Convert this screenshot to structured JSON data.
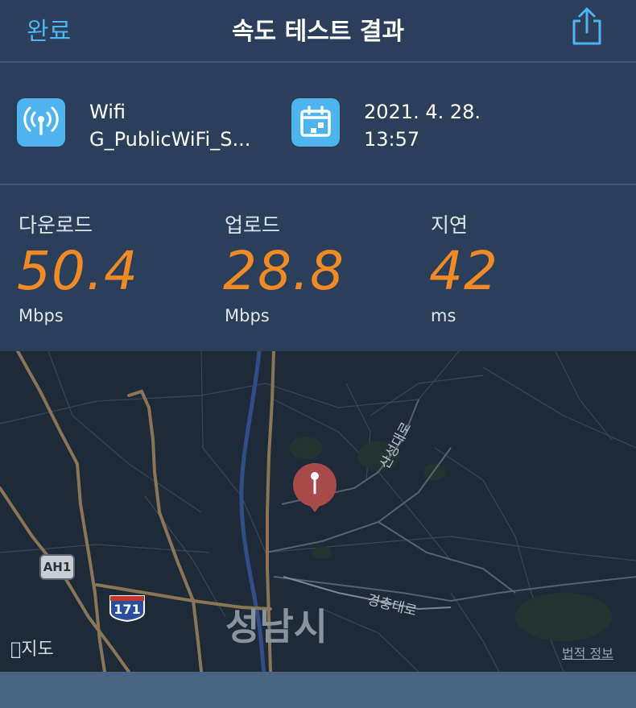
{
  "navbar": {
    "done_label": "완료",
    "title": "속도 테스트 결과",
    "share_icon": "share-icon"
  },
  "connection": {
    "type": "Wifi",
    "network_name": "G_PublicWiFi_S...",
    "icon": "wifi-antenna-icon"
  },
  "test_time": {
    "date": "2021. 4. 28.",
    "time": "13:57",
    "icon": "calendar-icon"
  },
  "metrics": {
    "download": {
      "label": "다운로드",
      "value": "50.4",
      "unit": "Mbps"
    },
    "upload": {
      "label": "업로드",
      "value": "28.8",
      "unit": "Mbps"
    },
    "latency": {
      "label": "지연",
      "value": "42",
      "unit": "ms"
    }
  },
  "map": {
    "city_label": "성남시",
    "road_labels": {
      "sanseong": "산성대로",
      "gyeongchung": "경충대로"
    },
    "highway_badges": {
      "ah1": "AH1",
      "interstate": "171"
    },
    "attribution": "지도",
    "legal_link": "법적 정보",
    "pin_icon": "location-pin-icon"
  },
  "colors": {
    "background": "#2b3f5a",
    "accent_blue": "#4fb3ee",
    "metric_orange": "#f08a24",
    "map_background": "#1f2a38"
  }
}
